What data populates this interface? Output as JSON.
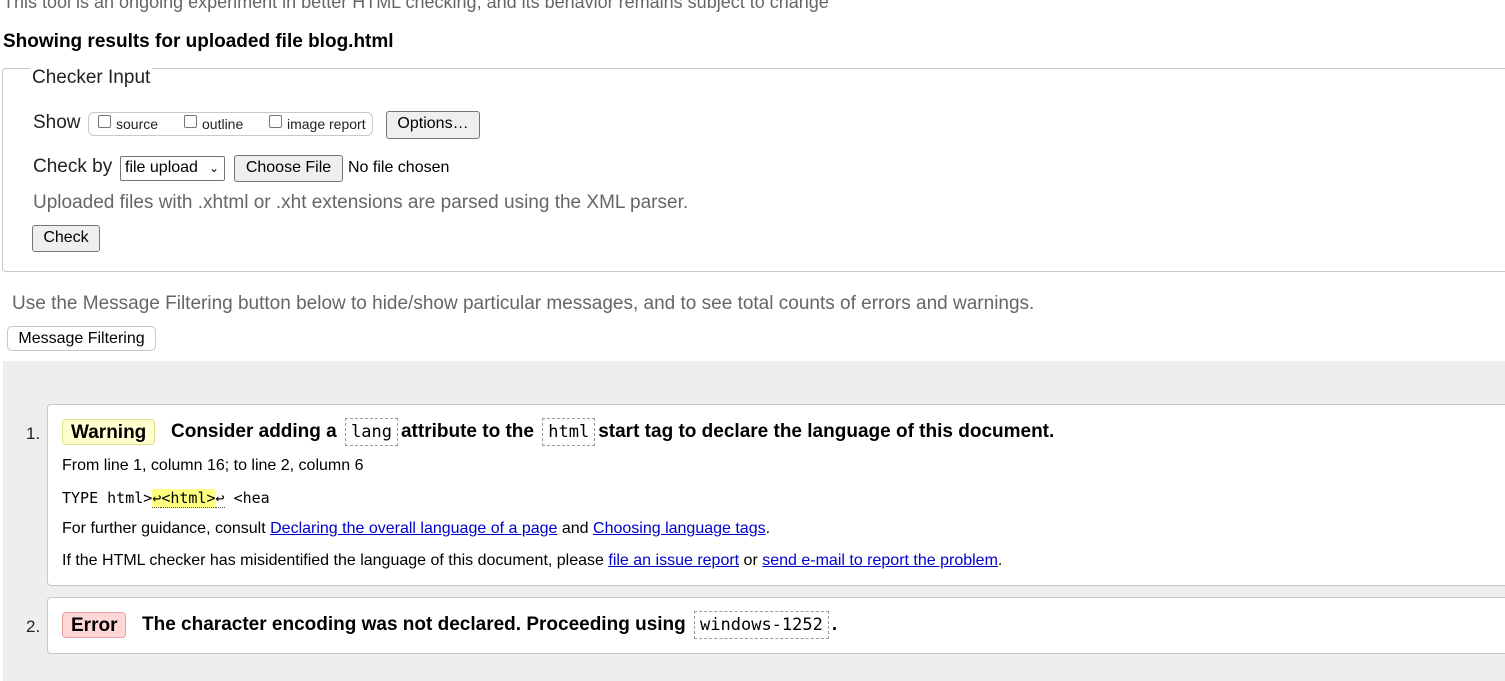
{
  "top_note": "This tool is an ongoing experiment in better HTML checking, and its behavior remains subject to change",
  "results_heading": "Showing results for uploaded file blog.html",
  "checker_input": {
    "legend": "Checker Input",
    "show_label": "Show",
    "show_options": [
      "source",
      "outline",
      "image report"
    ],
    "options_button": "Options…",
    "check_by_label": "Check by",
    "check_by_selected": "file upload",
    "choose_file_button": "Choose File",
    "no_file_text": "No file chosen",
    "xml_hint": "Uploaded files with .xhtml or .xht extensions are parsed using the XML parser.",
    "check_button": "Check"
  },
  "filter": {
    "hint": "Use the Message Filtering button below to hide/show particular messages, and to see total counts of errors and warnings.",
    "button": "Message Filtering"
  },
  "messages": [
    {
      "number": "1.",
      "type": "Warning",
      "title_parts": [
        "Consider adding a",
        "lang",
        "attribute to the",
        "html",
        "start tag to declare the language of this document."
      ],
      "location": "From line 1, column 16; to line 2, column 6",
      "extract_before": "TYPE html>",
      "extract_glyph1": "↩",
      "extract_highlight": "<html>",
      "extract_glyph2": "↩",
      "extract_after": " <hea",
      "guidance_prefix": "For further guidance, consult ",
      "guidance_link1": "Declaring the overall language of a page",
      "guidance_mid": " and ",
      "guidance_link2": "Choosing language tags",
      "guidance_suffix": ".",
      "misidentified_prefix": "If the HTML checker has misidentified the language of this document, please ",
      "misidentified_link1": "file an issue report",
      "misidentified_mid": " or ",
      "misidentified_link2": "send e-mail to report the problem",
      "misidentified_suffix": "."
    },
    {
      "number": "2.",
      "type": "Error",
      "title_text": "The character encoding was not declared. Proceeding using",
      "title_code": "windows-1252",
      "title_end": "."
    }
  ]
}
